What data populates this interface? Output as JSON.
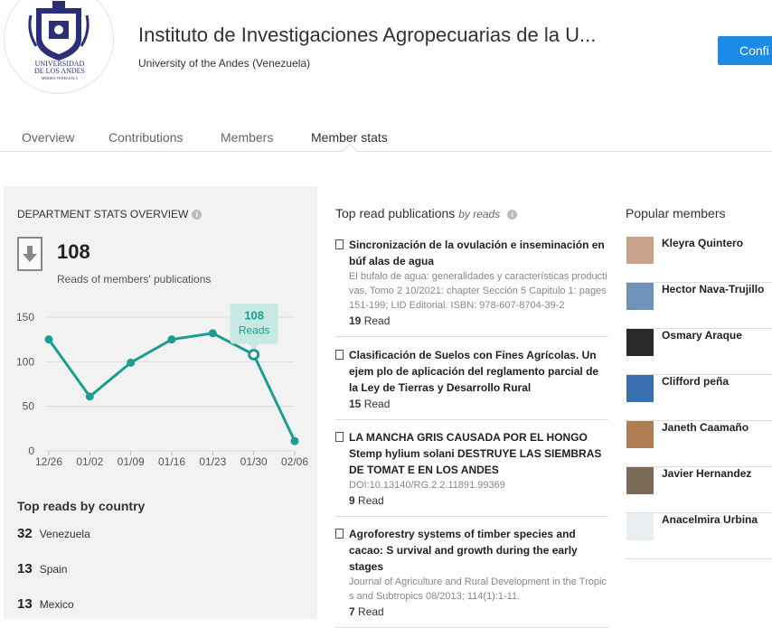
{
  "header": {
    "title": "Instituto de Investigaciones Agropecuarias de la U...",
    "subtitle": "University of the Andes (Venezuela)",
    "confirm_label": "Confi",
    "logo_text_1": "UNIVERSIDAD",
    "logo_text_2": "DE LOS ANDES",
    "logo_text_3": "MERIDA VENEZUELA"
  },
  "tabs": [
    {
      "label": "Overview"
    },
    {
      "label": "Contributions"
    },
    {
      "label": "Members"
    },
    {
      "label": "Member stats"
    }
  ],
  "stats": {
    "heading": "DEPARTMENT STATS OVERVIEW",
    "total_reads": "108",
    "total_caption": "Reads of members' publications",
    "tooltip_value": "108",
    "tooltip_label": "Reads",
    "country_heading": "Top reads by country",
    "countries": [
      {
        "count": "32",
        "name": "Venezuela"
      },
      {
        "count": "13",
        "name": "Spain"
      },
      {
        "count": "13",
        "name": "Mexico"
      }
    ]
  },
  "chart_data": {
    "type": "line",
    "categories": [
      "12/26",
      "01/02",
      "01/09",
      "01/16",
      "01/23",
      "01/30",
      "02/06"
    ],
    "values": [
      125,
      61,
      99,
      125,
      132,
      108,
      11
    ],
    "ylim": [
      0,
      150
    ],
    "yticks": [
      0,
      50,
      100,
      150
    ],
    "grid": true,
    "highlight_index": 5,
    "line_color": "#1a9e91"
  },
  "publications": {
    "heading": "Top read publications",
    "heading_suffix": "by reads",
    "items": [
      {
        "title": "Sincronización de la ovulación e inseminación en búf alas de agua",
        "meta": "El bufalo de agua: generalidades y características producti vas, Tomo 2 10/2021: chapter Sección 5 Capitulo 1: pages 151-199; LID Editorial. ISBN: 978-607-8704-39-2",
        "reads": "19",
        "reads_label": "Read"
      },
      {
        "title": "Clasificación de Suelos con Fines Agrícolas. Un ejem plo de aplicación del reglamento parcial de la Ley de Tierras y Desarrollo Rural",
        "meta": "",
        "reads": "15",
        "reads_label": "Read"
      },
      {
        "title": "LA MANCHA GRIS CAUSADA POR EL HONGO Stemp hylium solani DESTRUYE LAS SIEMBRAS DE TOMAT E EN LOS ANDES",
        "meta": "DOI:10.13140/RG.2.2.11891.99369",
        "reads": "9",
        "reads_label": "Read"
      },
      {
        "title": "Agroforestry systems of timber species and cacao: S urvival and growth during the early stages",
        "meta": "Journal of Agriculture and Rural Development in the Tropic s and Subtropics 08/2013; 114(1):1-11.",
        "reads": "7",
        "reads_label": "Read"
      }
    ]
  },
  "members": {
    "heading": "Popular members",
    "items": [
      {
        "name": "Kleyra Quintero",
        "color": "#c9a18a"
      },
      {
        "name": "Hector Nava-Trujillo",
        "color": "#6f93b8"
      },
      {
        "name": "Osmary Araque",
        "color": "#2b2b2b"
      },
      {
        "name": "Clifford peña",
        "color": "#3a6fb0"
      },
      {
        "name": "Janeth Caamaño",
        "color": "#b07c52"
      },
      {
        "name": "Javier Hernandez",
        "color": "#7c6a58"
      },
      {
        "name": "Anacelmira Urbina",
        "color": "#e8eef2"
      }
    ]
  }
}
